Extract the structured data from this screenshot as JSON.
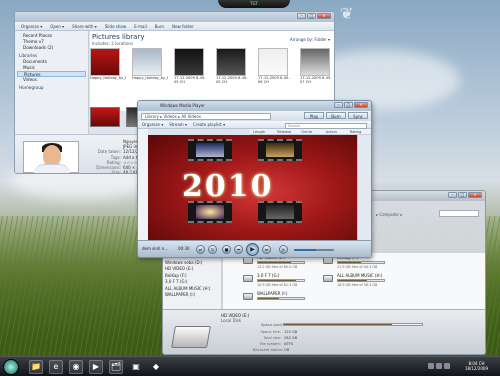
{
  "top_gadget": "TGT",
  "explorer": {
    "commands": [
      "Organize ▾",
      "Open ▾",
      "Share with ▾",
      "Slide show",
      "E-mail",
      "Burn",
      "New folder"
    ],
    "nav": [
      {
        "label": "Recent Places",
        "group": false
      },
      {
        "label": "Theme v7",
        "group": false
      },
      {
        "label": "Downloads (2)",
        "group": false
      },
      {
        "label": "Libraries",
        "group": true
      },
      {
        "label": "Documents",
        "group": false
      },
      {
        "label": "Music",
        "group": false
      },
      {
        "label": "Pictures",
        "group": false,
        "selected": true
      },
      {
        "label": "Videos",
        "group": false
      },
      {
        "label": "Homegroup",
        "group": true
      }
    ],
    "library_title": "Pictures library",
    "library_sub": "Includes: 2 locations",
    "arrange_by": "Arrange by: Folder ▾",
    "thumbs": [
      {
        "caption": "Happy_Holiday_by_Desicrotinterender"
      },
      {
        "caption": "Happy_Holiday_by_Desicrotinterender"
      },
      {
        "caption": "17-12-2009 6-49-05 CH"
      },
      {
        "caption": "17-12-2009 6-49-05 CH"
      },
      {
        "caption": "17-12-2009 6-49-06 CH"
      },
      {
        "caption": "17-12-2009 6-49-07 CH"
      }
    ],
    "details": {
      "name": "Nguyen Khue",
      "rows": [
        {
          "k": "",
          "v": "Nguyen Khue"
        },
        {
          "k": "",
          "v": "JPEG image"
        },
        {
          "k": "Date taken:",
          "v": "12/12/2009"
        },
        {
          "k": "Tags:",
          "v": "Add a tag"
        },
        {
          "k": "Rating:",
          "v": "☆☆☆☆☆"
        },
        {
          "k": "Dimensions:",
          "v": "640 × 480"
        },
        {
          "k": "Size:",
          "v": "48.2 KB"
        }
      ]
    }
  },
  "wmp": {
    "title": "Windows Media Player",
    "breadcrumb": "Library ▸ Videos ▸ All Videos",
    "tabs": [
      "Play",
      "Burn",
      "Sync"
    ],
    "toolbar": [
      "Organize ▾",
      "Stream ▾",
      "Create playlist ▾"
    ],
    "search_placeholder": "Search",
    "columns": [
      "Length",
      "Release year",
      "Genre",
      "Actors",
      "Rating"
    ],
    "banner_text": "2010",
    "now_playing": "dem sinh n...",
    "elapsed": "00:30",
    "controls": [
      "⇄",
      "↻",
      "■",
      "⏮",
      "⏭",
      "🔊"
    ],
    "play_symbol": "▶",
    "volume_level": 0.55
  },
  "computer": {
    "title": "Computer",
    "path": "▸ Computer ▸",
    "nav": [
      "Local Disk",
      "Windows seba (D:)",
      "HD VIDEO (E:)",
      "BeiKap (F:)",
      "3.0 F T (G:)",
      "ALL ALBUM MUSIC (H:)",
      "WALLPAPER (I:)"
    ],
    "drives": [
      {
        "name": "HD VIDEO (E:)",
        "used": 0.72,
        "free": "13.2 GB free of 60.0 GB"
      },
      {
        "name": "BeiKap (F:)",
        "used": 0.5,
        "free": "21.9 GB free of 44.3 GB"
      },
      {
        "name": "3.0 F T (G:)",
        "used": 0.82,
        "free": "10.9 GB free of 61.3 GB"
      },
      {
        "name": "ALL ALBUM MUSIC (H:)",
        "used": 0.64,
        "free": "18.9 GB free of 58.3 GB"
      },
      {
        "name": "WALLPAPER (I:)",
        "used": 0.45,
        "free": ""
      }
    ],
    "details": {
      "title": "HD VIDEO (E:)",
      "subtitle": "Local Disk",
      "used_label": "Space used:",
      "used": 0.78,
      "rows": [
        {
          "k": "Space free:",
          "v": "120 GB"
        },
        {
          "k": "Total size:",
          "v": "282 GB"
        },
        {
          "k": "File system:",
          "v": "NTFS"
        },
        {
          "k": "BitLocker status:",
          "v": "Off"
        }
      ]
    }
  },
  "taskbar": {
    "icons": [
      {
        "name": "folder-icon",
        "glyph": "📁"
      },
      {
        "name": "ie-icon",
        "glyph": "e"
      },
      {
        "name": "firefox-icon",
        "glyph": "◉"
      },
      {
        "name": "media-player-icon",
        "glyph": "▶"
      },
      {
        "name": "explorer-icon",
        "glyph": "🗂"
      },
      {
        "name": "photo-icon",
        "glyph": "▣"
      },
      {
        "name": "app-icon",
        "glyph": "◆"
      }
    ],
    "clock_time": "8:04 CH",
    "clock_date": "18/12/2009"
  }
}
